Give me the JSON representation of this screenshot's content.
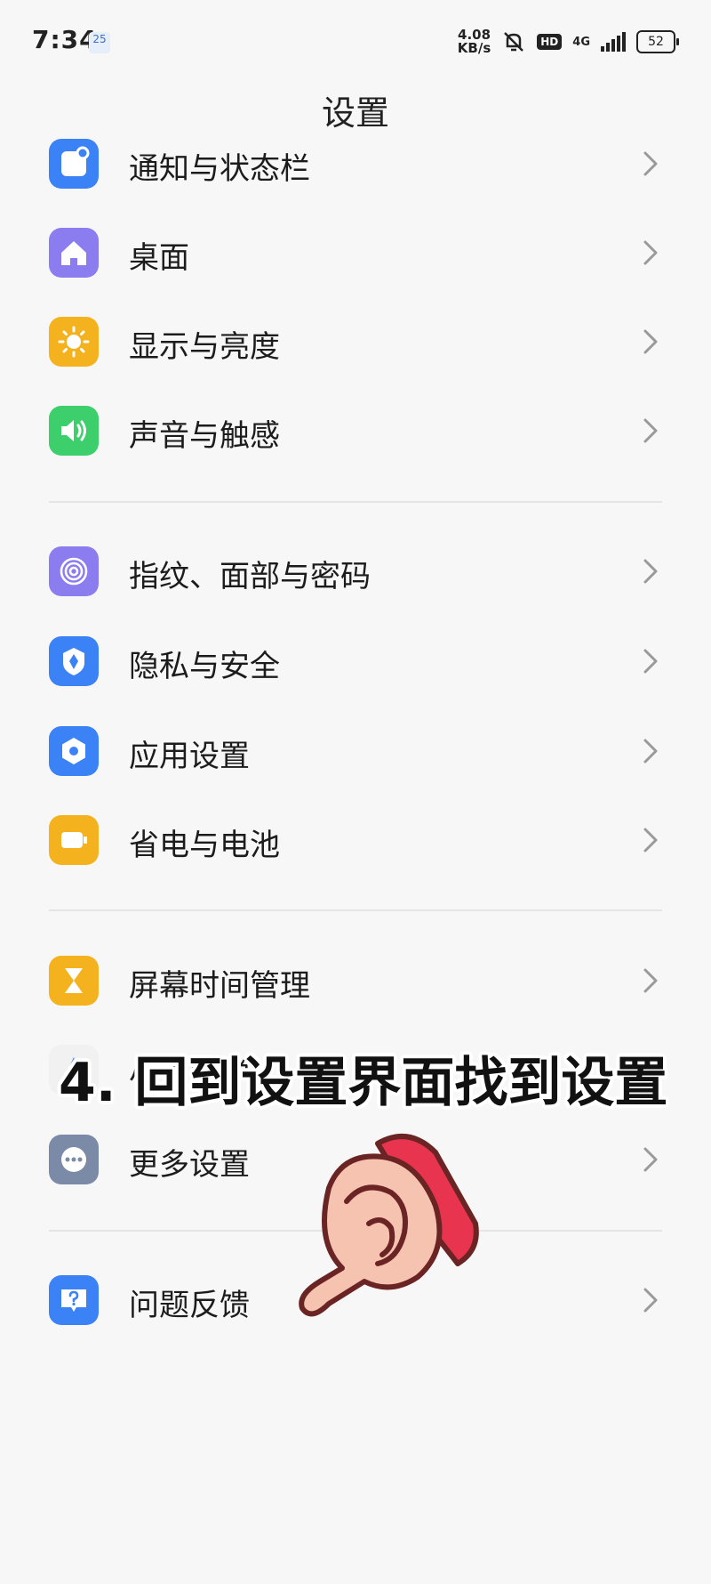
{
  "status_bar": {
    "time": "7:34",
    "date_badge": "25",
    "net_speed": "4.08",
    "net_speed_unit": "KB/s",
    "hd_label": "HD",
    "network_type": "4G",
    "battery": "52"
  },
  "header": {
    "title": "设置"
  },
  "items": [
    {
      "label": "通知与状态栏",
      "icon": "notification-icon",
      "color": "#3b82f6"
    },
    {
      "label": "桌面",
      "icon": "home-icon",
      "color": "#8b7cf0"
    },
    {
      "label": "显示与亮度",
      "icon": "sun-icon",
      "color": "#f5b21f"
    },
    {
      "label": "声音与触感",
      "icon": "speaker-icon",
      "color": "#3ccf6b"
    },
    {
      "label": "指纹、面部与密码",
      "icon": "fingerprint-icon",
      "color": "#8b7cf0"
    },
    {
      "label": "隐私与安全",
      "icon": "shield-icon",
      "color": "#3b82f6"
    },
    {
      "label": "应用设置",
      "icon": "hexagon-gear-icon",
      "color": "#3b82f6"
    },
    {
      "label": "省电与电池",
      "icon": "battery-icon",
      "color": "#f5b21f"
    },
    {
      "label": "屏幕时间管理",
      "icon": "hourglass-icon",
      "color": "#f5b21f"
    },
    {
      "label": "小爱同学",
      "icon": "xiaoai-icon",
      "color": "#ffffff"
    },
    {
      "label": "更多设置",
      "icon": "more-icon",
      "color": "#7b8aa6"
    },
    {
      "label": "问题反馈",
      "icon": "question-icon",
      "color": "#3b82f6"
    }
  ],
  "overlay": {
    "caption": "4. 回到设置界面找到设置"
  }
}
